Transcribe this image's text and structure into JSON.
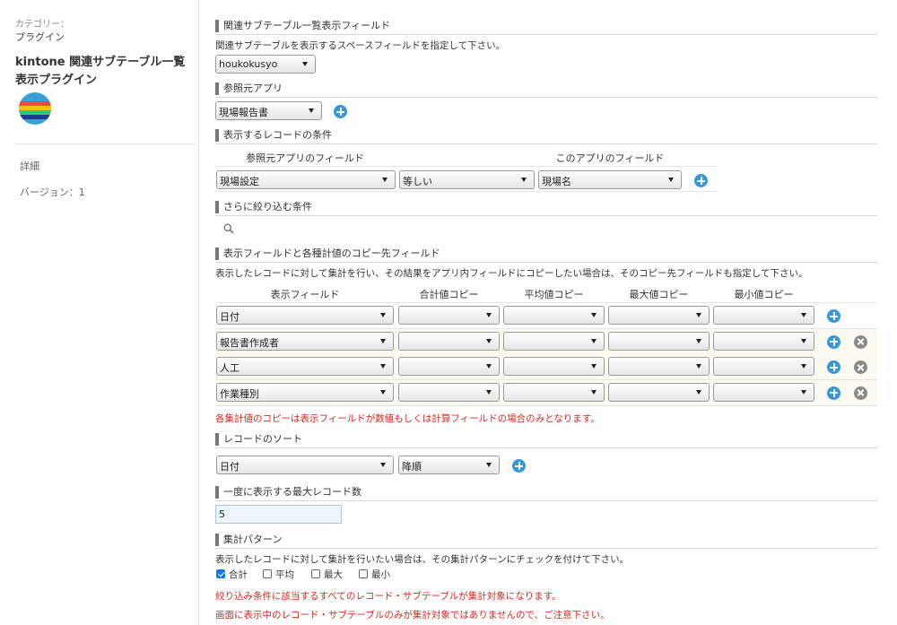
{
  "sidebar": {
    "category_label": "カテゴリー：",
    "category_value": "プラグイン",
    "plugin_name": "kintone 関連サブテーブル一覧表示プラグイン",
    "detail_label": "詳細",
    "version_label": "バージョン：1"
  },
  "sections": {
    "related_subtable": {
      "title": "関連サブテーブル一覧表示フィールド",
      "desc": "関連サブテーブルを表示するスペースフィールドを指定して下さい。",
      "selected": "houkokusyo"
    },
    "source_app": {
      "title": "参照元アプリ",
      "selected": "現場報告書"
    },
    "conditions": {
      "title": "表示するレコードの条件",
      "col_source": "参照元アプリのフィールド",
      "col_this": "このアプリのフィールド",
      "source_field": "現場設定",
      "operator": "等しい",
      "this_field": "現場名"
    },
    "filter": {
      "title": "さらに絞り込む条件"
    },
    "display_fields": {
      "title": "表示フィールドと各種計値のコピー先フィールド",
      "desc": "表示したレコードに対して集計を行い、その結果をアプリ内フィールドにコピーしたい場合は、そのコピー先フィールドも指定して下さい。",
      "headers": [
        "表示フィールド",
        "合計値コピー",
        "平均値コピー",
        "最大値コピー",
        "最小値コピー"
      ],
      "rows": [
        "日付",
        "報告書作成者",
        "人工",
        "作業種別"
      ],
      "note": "各集計値のコピーは表示フィールドが数値もしくは計算フィールドの場合のみとなります。"
    },
    "sort": {
      "title": "レコードのソート",
      "field": "日付",
      "order": "降順"
    },
    "max_records": {
      "title": "一度に表示する最大レコード数",
      "value": "5"
    },
    "aggregate": {
      "title": "集計パターン",
      "desc": "表示したレコードに対して集計を行いたい場合は、その集計パターンにチェックを付けて下さい。",
      "options": [
        {
          "label": "合計",
          "checked": true
        },
        {
          "label": "平均",
          "checked": false
        },
        {
          "label": "最大",
          "checked": false
        },
        {
          "label": "最小",
          "checked": false
        }
      ],
      "note1": "絞り込み条件に該当するすべてのレコード・サブテーブルが集計対象になります。",
      "note2": "画面に表示中のレコード・サブテーブルのみが集計対象ではありませんので、ご注意下さい。"
    }
  },
  "colors": {
    "accent_blue": "#3598db",
    "remove_gray": "#8a8a8a",
    "warning_red": "#d62a1e",
    "alt_row": "#fbfaf0"
  }
}
